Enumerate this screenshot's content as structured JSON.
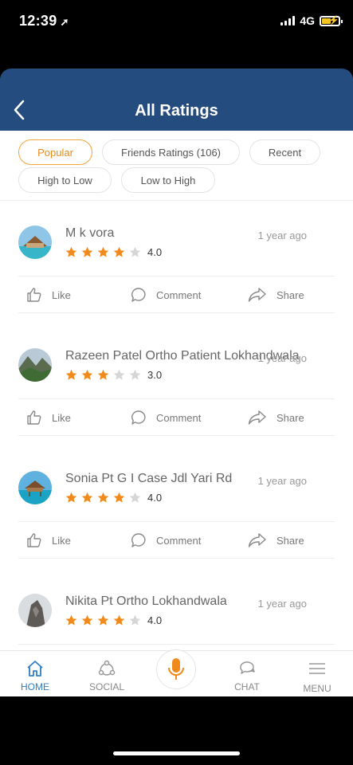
{
  "status_bar": {
    "time": "12:39",
    "network": "4G"
  },
  "header": {
    "title": "All Ratings"
  },
  "filters": [
    {
      "label": "Popular",
      "active": true
    },
    {
      "label": "Friends Ratings (106)",
      "active": false
    },
    {
      "label": "Recent",
      "active": false
    },
    {
      "label": "High to Low",
      "active": false
    },
    {
      "label": "Low to High",
      "active": false
    }
  ],
  "ratings": [
    {
      "name": "M k vora",
      "time": "1 year ago",
      "rating": "4.0",
      "stars": 4
    },
    {
      "name": "Razeen Patel Ortho Patient Lokhandwala",
      "time": "1 year ago",
      "rating": "3.0",
      "stars": 3
    },
    {
      "name": "Sonia Pt G I Case Jdl Yari Rd",
      "time": "1 year ago",
      "rating": "4.0",
      "stars": 4
    },
    {
      "name": "Nikita Pt Ortho Lokhandwala",
      "time": "1 year ago",
      "rating": "4.0",
      "stars": 4
    }
  ],
  "actions": {
    "like": "Like",
    "comment": "Comment",
    "share": "Share"
  },
  "bottom_nav": {
    "home": "HOME",
    "social": "SOCIAL",
    "chat": "CHAT",
    "menu": "MENU"
  },
  "colors": {
    "header": "#244c7f",
    "accent": "#f1a33c",
    "star_filled": "#f08a1c",
    "star_empty": "#d6d6d6",
    "nav_active": "#2e80c7"
  }
}
